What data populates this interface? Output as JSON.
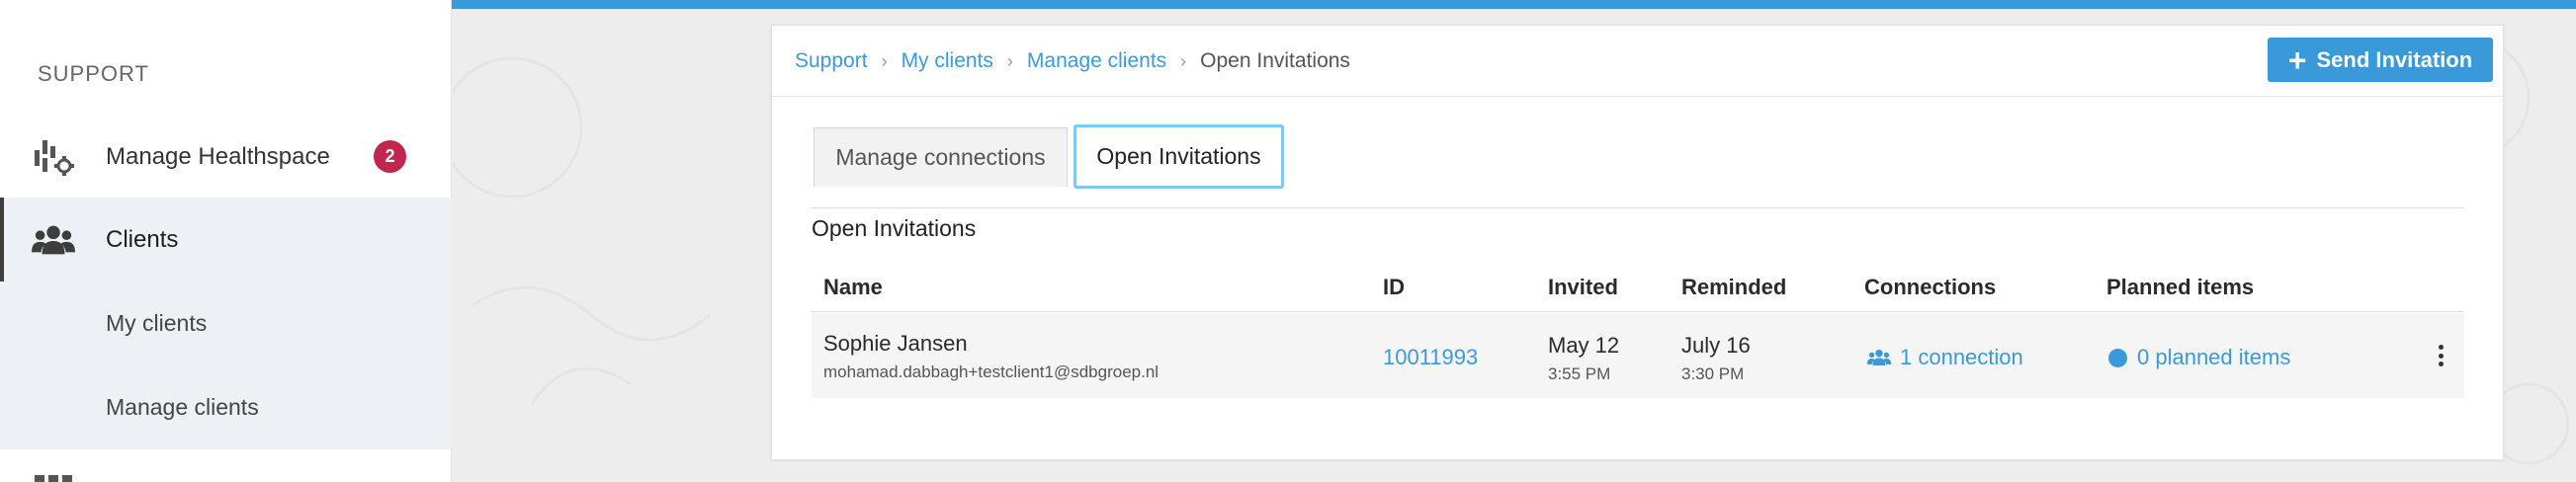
{
  "sidebar": {
    "heading": "SUPPORT",
    "items": [
      {
        "label": "Manage Healthspace",
        "icon": "healthspace-icon",
        "badge": "2"
      },
      {
        "label": "Clients",
        "icon": "users-icon",
        "active": true
      }
    ],
    "subitems": [
      {
        "label": "My clients"
      },
      {
        "label": "Manage clients"
      }
    ]
  },
  "breadcrumb": {
    "items": [
      "Support",
      "My clients",
      "Manage clients"
    ],
    "current": "Open Invitations"
  },
  "toolbar": {
    "send_label": "Send Invitation"
  },
  "tabs": [
    {
      "label": "Manage connections",
      "active": false
    },
    {
      "label": "Open Invitations",
      "active": true
    }
  ],
  "section_title": "Open Invitations",
  "table": {
    "columns": [
      "Name",
      "ID",
      "Invited",
      "Reminded",
      "Connections",
      "Planned items"
    ],
    "rows": [
      {
        "name": "Sophie Jansen",
        "email": "mohamad.dabbagh+testclient1@sdbgroep.nl",
        "id": "10011993",
        "invited_date": "May 12",
        "invited_time": "3:55 PM",
        "reminded_date": "July 16",
        "reminded_time": "3:30 PM",
        "connections": "1 connection",
        "planned": "0 planned items"
      }
    ]
  },
  "colors": {
    "accent": "#3a9ad9",
    "badge": "#c2254d",
    "active_bg": "#edf1f5"
  }
}
